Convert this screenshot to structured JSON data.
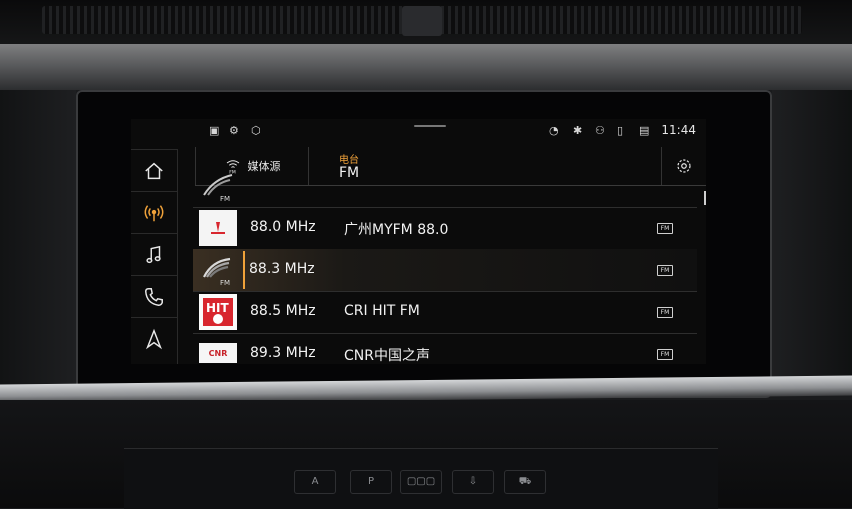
{
  "status_bar": {
    "time": "11:44",
    "icons": [
      "car-icon",
      "connectivity-icon",
      "package-icon",
      "voice-icon",
      "bluetooth-icon",
      "person-icon",
      "phone-icon",
      "signal-icon"
    ]
  },
  "nav": {
    "items": [
      {
        "id": "home",
        "icon": "home-icon"
      },
      {
        "id": "radio",
        "icon": "radio-icon",
        "active": true
      },
      {
        "id": "media",
        "icon": "music-note-icon"
      },
      {
        "id": "phone",
        "icon": "phone-icon"
      },
      {
        "id": "navigation",
        "icon": "navigation-arrow-icon"
      }
    ]
  },
  "header": {
    "source_label": "媒体源",
    "source_icon_label": "FM",
    "category": "电台",
    "band": "FM"
  },
  "stations": [
    {
      "logo": "fm-wave-logo",
      "logo_text": "FM",
      "frequency": "",
      "name": "",
      "partial": true
    },
    {
      "logo": "myfm-logo",
      "frequency": "88.0 MHz",
      "name": "广州MYFM 88.0",
      "badge": "FM"
    },
    {
      "logo": "fm-wave-logo",
      "logo_text": "FM",
      "frequency": "88.3 MHz",
      "name": "",
      "badge": "FM",
      "selected": true
    },
    {
      "logo": "hitfm-logo",
      "logo_text": "HIT",
      "frequency": "88.5 MHz",
      "name": "CRI HIT FM",
      "badge": "FM"
    },
    {
      "logo": "cnr-logo",
      "logo_text": "CNR",
      "frequency": "89.3 MHz",
      "name": "CNR中国之声",
      "badge": "FM"
    }
  ],
  "colors": {
    "accent": "#f0a23a",
    "text": "#f2f2f2",
    "background": "#0b0b0b"
  },
  "lower_controls": [
    "A",
    "P",
    "",
    ""
  ]
}
